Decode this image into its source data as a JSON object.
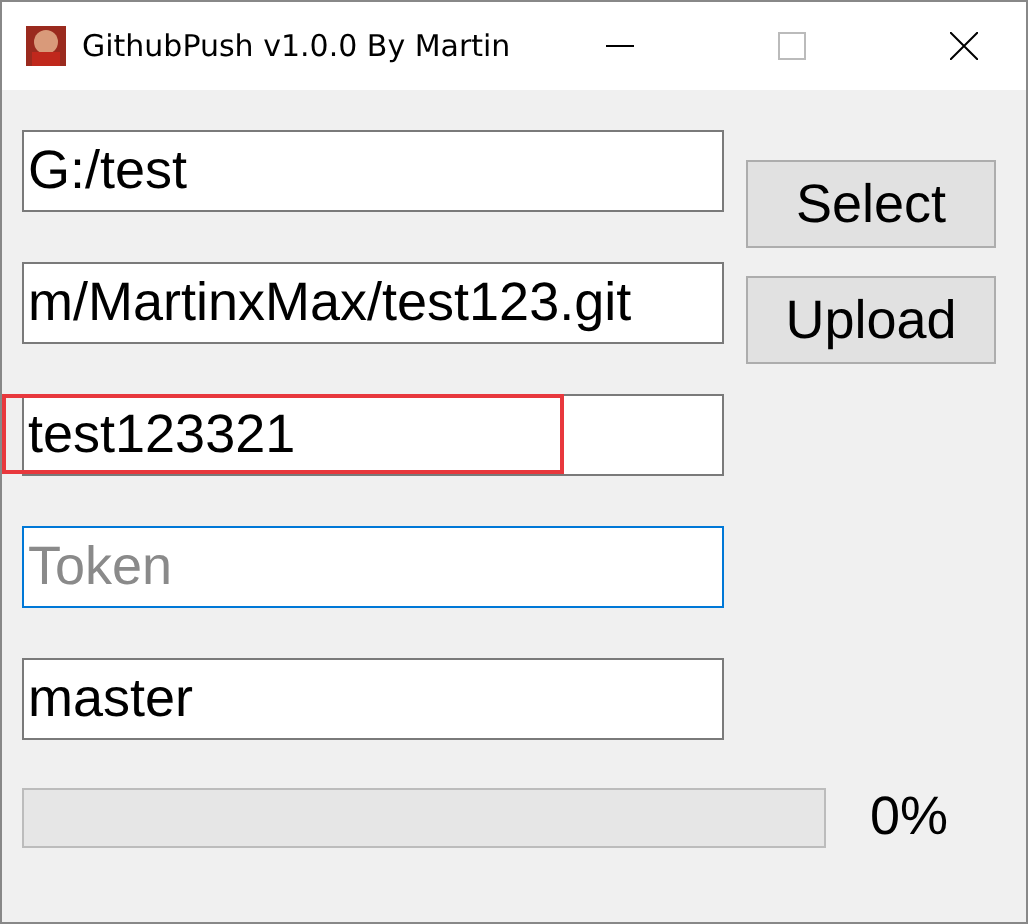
{
  "window": {
    "title": "GithubPush v1.0.0 By Martin"
  },
  "fields": [
    {
      "value": "G:/test",
      "focused": false,
      "highlighted": false
    },
    {
      "value": "m/MartinxMax/test123.git",
      "focused": false,
      "highlighted": false
    },
    {
      "value": "test123321",
      "focused": false,
      "highlighted": true
    },
    {
      "placeholder": "Token",
      "focused": true,
      "highlighted": false
    },
    {
      "value": "master",
      "focused": false,
      "highlighted": false
    }
  ],
  "buttons": [
    "Select",
    "Upload"
  ],
  "progress": {
    "level": 0,
    "reading": "0%"
  }
}
